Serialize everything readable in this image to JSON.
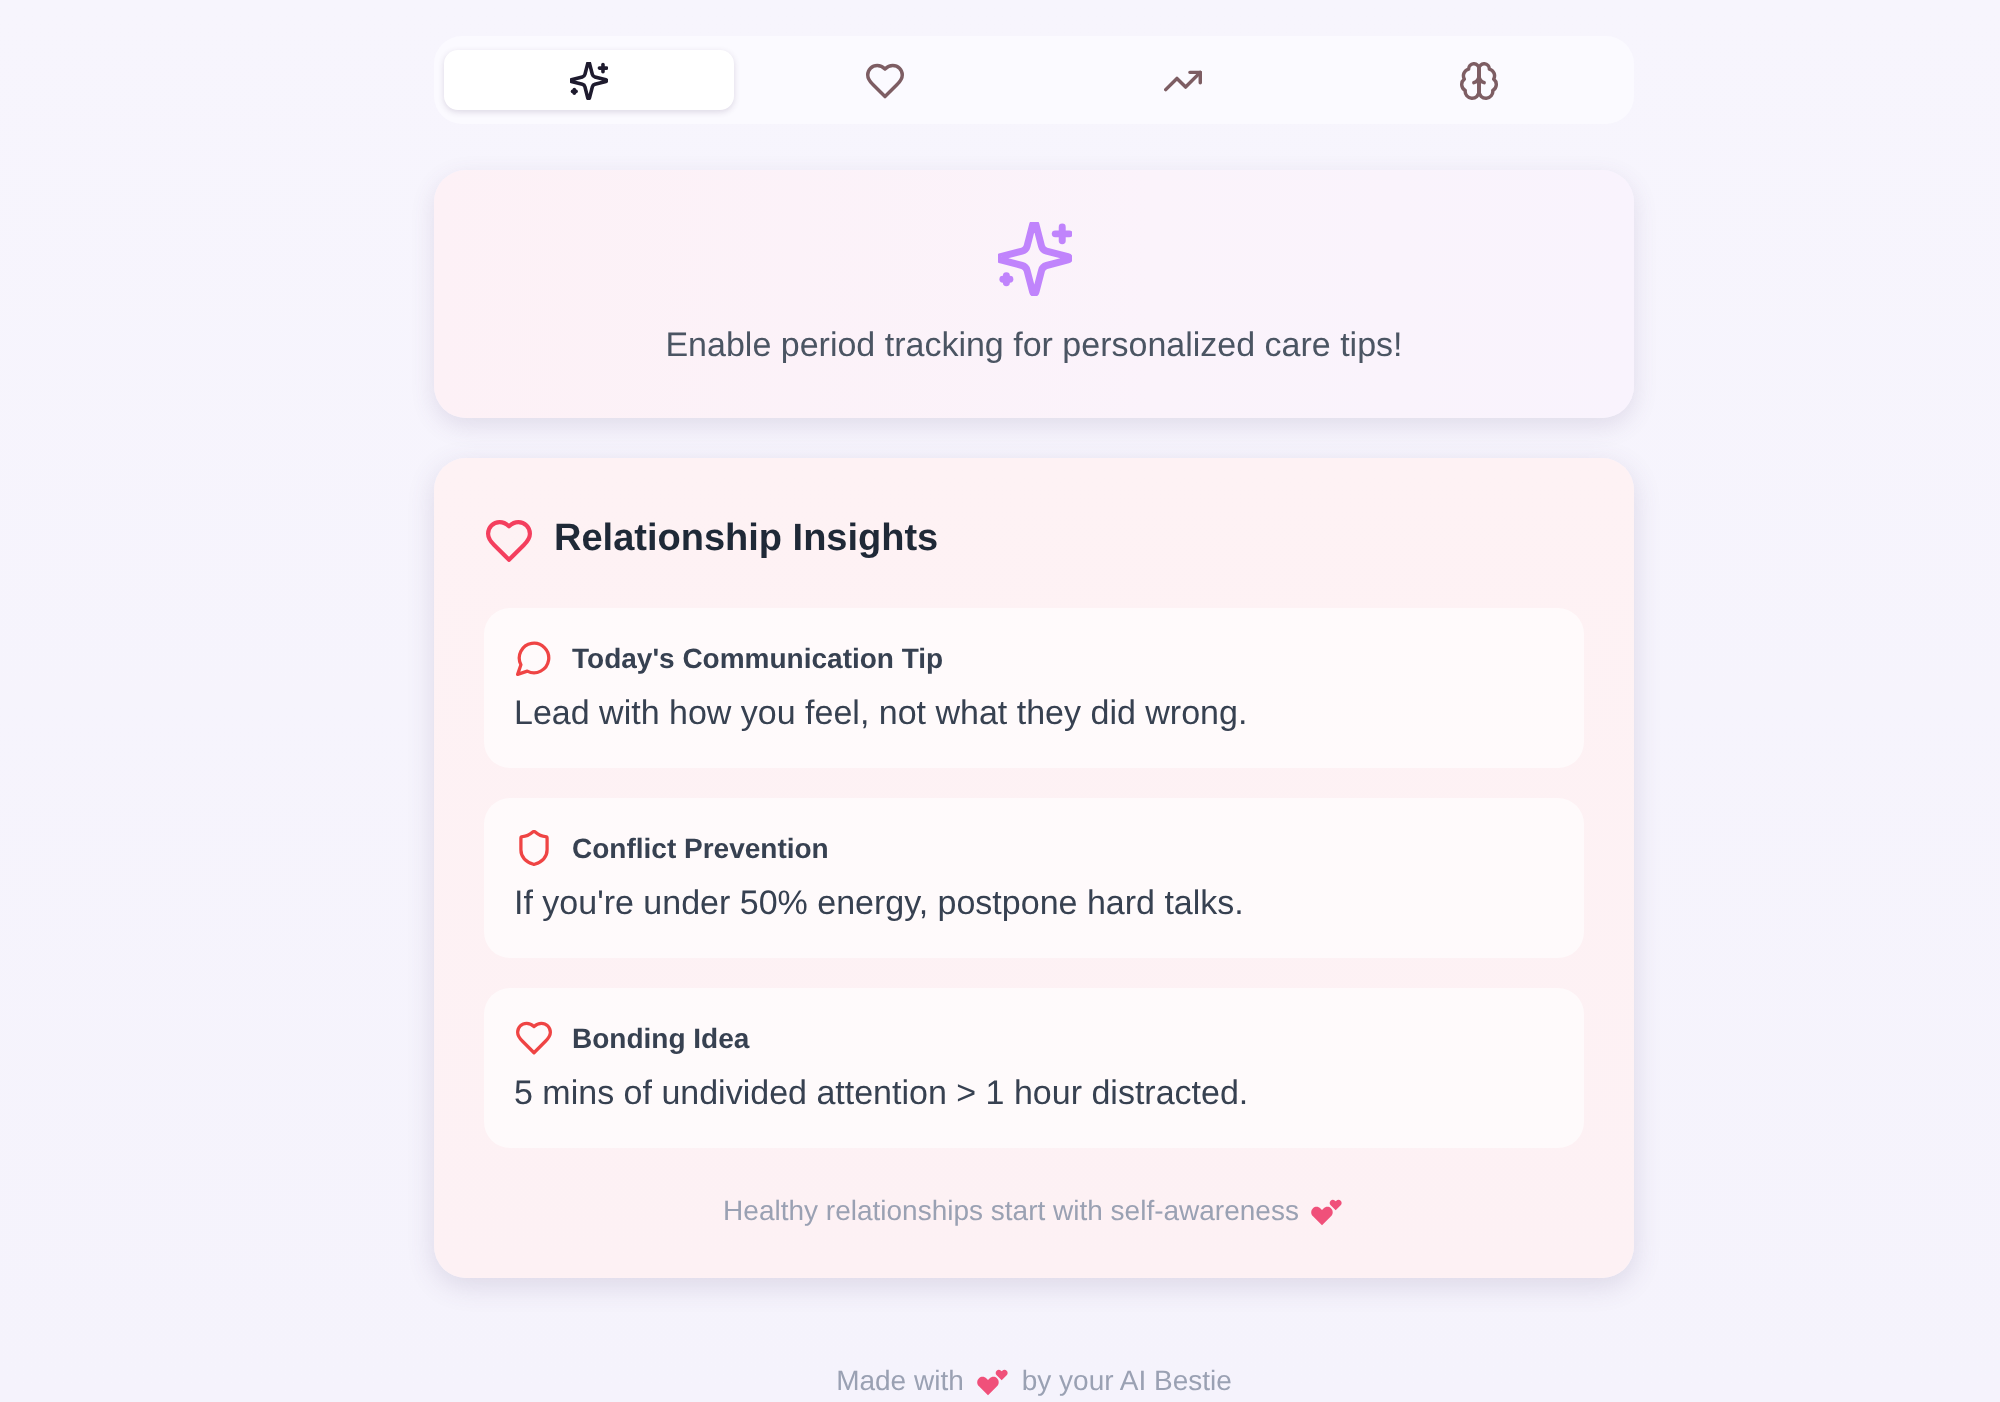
{
  "tabs": [
    {
      "kind": "sparkles",
      "selected": true
    },
    {
      "kind": "heart",
      "selected": false
    },
    {
      "kind": "trend",
      "selected": false
    },
    {
      "kind": "brain",
      "selected": false
    }
  ],
  "tracking_prompt": {
    "text": "Enable period tracking for personalized care tips!"
  },
  "relationship_insights": {
    "title": "Relationship Insights",
    "tips": [
      {
        "kind": "chat",
        "title": "Today's Communication Tip",
        "text": "Lead with how you feel, not what they did wrong."
      },
      {
        "kind": "shield",
        "title": "Conflict Prevention",
        "text": "If you're under 50% energy, postpone hard talks."
      },
      {
        "kind": "heart",
        "title": "Bonding Idea",
        "text": "5 mins of undivided attention > 1 hour distracted."
      }
    ],
    "tagline": "Healthy relationships start with self-awareness"
  },
  "footer": {
    "before": "Made with",
    "after": "by your AI Bestie"
  }
}
